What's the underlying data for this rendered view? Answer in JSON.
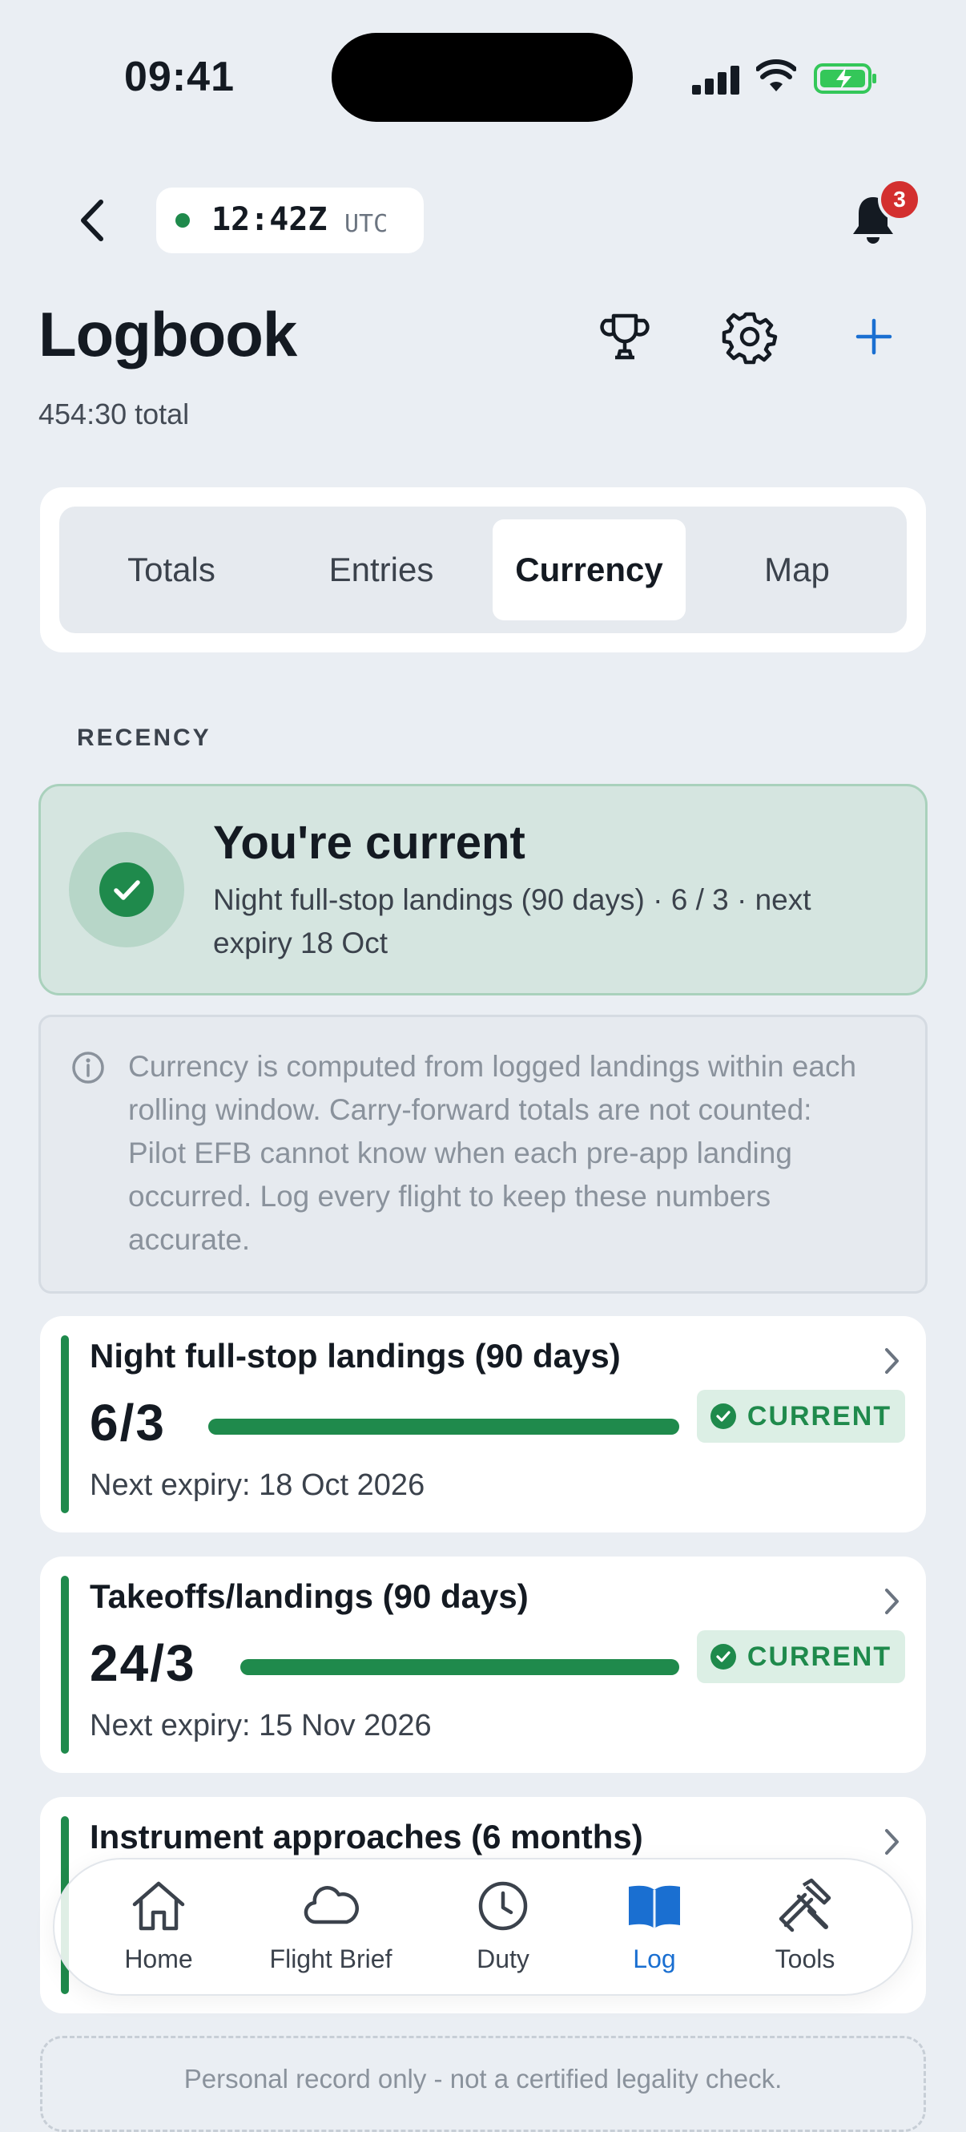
{
  "status_bar": {
    "time": "09:41"
  },
  "header": {
    "utc_time": "12:42Z",
    "utc_label": "UTC",
    "notification_count": "3",
    "title": "Logbook",
    "subtitle": "454:30 total"
  },
  "tabs": [
    {
      "label": "Totals",
      "active": false
    },
    {
      "label": "Entries",
      "active": false
    },
    {
      "label": "Currency",
      "active": true
    },
    {
      "label": "Map",
      "active": false
    }
  ],
  "recency": {
    "section_label": "RECENCY",
    "banner_title": "You're current",
    "banner_subtitle": "Night full-stop landings (90 days) · 6 / 3 · next expiry 18 Oct"
  },
  "info_note": "Currency is computed from logged landings within each rolling window. Carry-forward totals are not counted: Pilot EFB cannot know when each pre-app landing occurred. Log every flight to keep these numbers accurate.",
  "currency_items": [
    {
      "title": "Night full-stop landings (90 days)",
      "ratio": "6/3",
      "progress": 1.0,
      "status": "CURRENT",
      "next_expiry": "Next expiry: 18 Oct 2026"
    },
    {
      "title": "Takeoffs/landings (90 days)",
      "ratio": "24/3",
      "progress": 1.0,
      "status": "CURRENT",
      "next_expiry": "Next expiry: 15 Nov 2026"
    },
    {
      "title": "Instrument approaches (6 months)"
    }
  ],
  "disclaimer": "Personal record only - not a certified legality check.",
  "tab_bar": [
    {
      "label": "Home",
      "icon": "home-icon",
      "active": false
    },
    {
      "label": "Flight Brief",
      "icon": "cloud-icon",
      "active": false
    },
    {
      "label": "Duty",
      "icon": "clock-icon",
      "active": false
    },
    {
      "label": "Log",
      "icon": "book-icon",
      "active": true
    },
    {
      "label": "Tools",
      "icon": "tools-icon",
      "active": false
    }
  ],
  "colors": {
    "background": "#eaeef3",
    "accent_blue": "#1a6fd1",
    "current_green": "#1f8a4c",
    "badge_red": "#d32f2f"
  }
}
